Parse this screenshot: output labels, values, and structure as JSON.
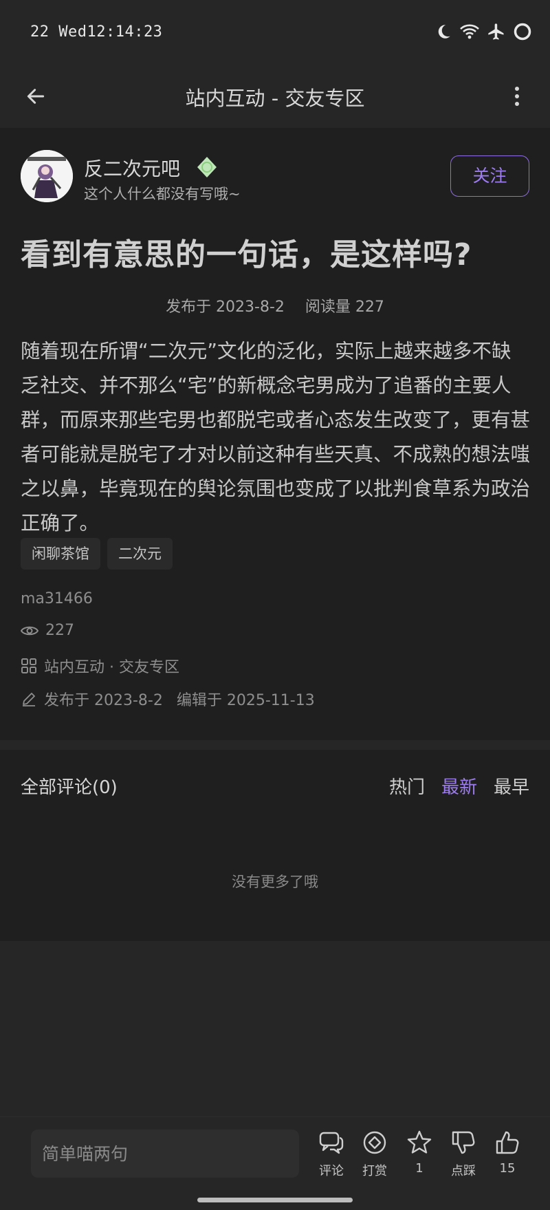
{
  "status_bar": {
    "time": "22 Wed12:14:23"
  },
  "app_bar": {
    "title": "站内互动 - 交友专区"
  },
  "author": {
    "name": "反二次元吧",
    "bio": "这个人什么都没有写哦~",
    "follow_label": "关注"
  },
  "post": {
    "title": "看到有意思的一句话，是这样吗?",
    "published": "发布于 2023-8-2",
    "reads": "阅读量 227",
    "body": "随着现在所谓“二次元”文化的泛化，实际上越来越多不缺乏社交、并不那么“宅”的新概念宅男成为了追番的主要人群，而原来那些宅男也都脱宅或者心态发生改变了，更有甚者可能就是脱宅了才对以前这种有些天真、不成熟的想法嗤之以鼻，毕竟现在的舆论氛围也变成了以批判食草系为政治正确了。",
    "tags": [
      "闲聊茶馆",
      "二次元"
    ],
    "username": "ma31466",
    "views": "227",
    "section": "站内互动 · 交友专区",
    "published_short": "发布于 2023-8-2",
    "edited": "编辑于 2025-11-13"
  },
  "comments": {
    "title": "全部评论(0)",
    "sort_tabs": [
      "热门",
      "最新",
      "最早"
    ],
    "active_sort": "最新",
    "empty_text": "没有更多了哦"
  },
  "bottom_bar": {
    "input_placeholder": "简单喵两句",
    "actions": [
      {
        "icon": "comment-icon",
        "label": "评论"
      },
      {
        "icon": "reward-icon",
        "label": "打赏"
      },
      {
        "icon": "star-icon",
        "label": "1"
      },
      {
        "icon": "thumbs-down-icon",
        "label": "点踩"
      },
      {
        "icon": "thumbs-up-icon",
        "label": "15"
      }
    ]
  },
  "colors": {
    "accent": "#9d7cf0",
    "background": "#262626",
    "card": "#1f1f1f"
  }
}
